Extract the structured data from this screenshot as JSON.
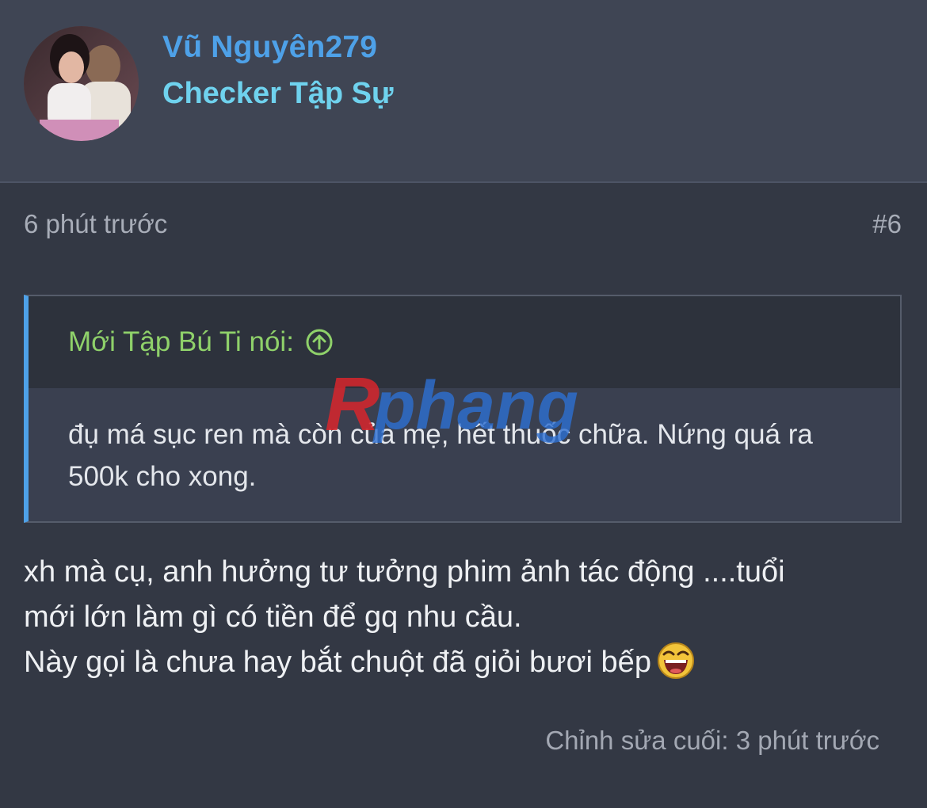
{
  "user": {
    "name": "Vũ Nguyên279",
    "title": "Checker Tập Sự",
    "avatar_icon": "avatar-photo"
  },
  "post": {
    "time": "6 phút trước",
    "number": "#6",
    "quote": {
      "author_label": "Mới Tập Bú Ti nói:",
      "jump_icon": "arrow-up-circle-icon",
      "text": "đụ má sục ren mà còn của mẹ, hết thuốc chữa. Nứng quá ra 500k cho xong."
    },
    "reply_lines": [
      "xh mà cụ, anh hưởng tư tưởng phim ảnh tác động ....tuổi",
      "mới lớn làm gì có tiền để gq nhu cầu.",
      "Này gọi là chưa hay bắt chuột đã giỏi bươi bếp"
    ],
    "reply_emoji": "laughing-emoji-icon",
    "edited": "Chỉnh sửa cuối: 3 phút trước"
  },
  "watermark": {
    "text_left": "R",
    "text_right": "phang"
  },
  "colors": {
    "background": "#333844",
    "header_bg": "#3f4554",
    "username": "#4ea1e8",
    "user_title": "#6fd2ee",
    "quote_author": "#8fd16a",
    "quote_accent": "#4ea1e8",
    "muted_text": "#a8adb8"
  }
}
